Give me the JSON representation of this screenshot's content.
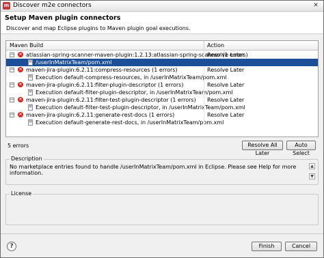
{
  "window": {
    "title": "Discover m2e connectors",
    "close_glyph": "✕",
    "icon": "m2e-icon"
  },
  "header": {
    "title": "Setup Maven plugin connectors",
    "description": "Discover and map Eclipse plugins to Maven plugin goal executions."
  },
  "table": {
    "columns": [
      "Maven Build",
      "Action"
    ],
    "rows": [
      {
        "kind": "plugin",
        "text": "atlassian-spring-scanner-maven-plugin:1.2.13:atlassian-spring-scanner (1 errors)",
        "action": "Resolve Later",
        "selected": false
      },
      {
        "kind": "file",
        "text": "/userInMatrixTeam/pom.xml",
        "action": "",
        "selected": true
      },
      {
        "kind": "plugin",
        "text": "maven-jira-plugin:6.2.11:compress-resources (1 errors)",
        "action": "Resolve Later",
        "selected": false
      },
      {
        "kind": "file",
        "text": "Execution default-compress-resources, in /userInMatrixTeam/pom.xml",
        "action": "",
        "selected": false
      },
      {
        "kind": "plugin",
        "text": "maven-jira-plugin:6.2.11:filter-plugin-descriptor (1 errors)",
        "action": "Resolve Later",
        "selected": false
      },
      {
        "kind": "file",
        "text": "Execution default-filter-plugin-descriptor, in /userInMatrixTeam/pom.xml",
        "action": "",
        "selected": false
      },
      {
        "kind": "plugin",
        "text": "maven-jira-plugin:6.2.11:filter-test-plugin-descriptor (1 errors)",
        "action": "Resolve Later",
        "selected": false
      },
      {
        "kind": "file",
        "text": "Execution default-filter-test-plugin-descriptor, in /userInMatrixTeam/pom.xml",
        "action": "",
        "selected": false
      },
      {
        "kind": "plugin",
        "text": "maven-jira-plugin:6.2.11:generate-rest-docs (1 errors)",
        "action": "Resolve Later",
        "selected": false
      },
      {
        "kind": "file",
        "text": "Execution default-generate-rest-docs, in /userInMatrixTeam/pom.xml",
        "action": "",
        "selected": false
      }
    ],
    "expander_glyph": "−",
    "error_glyph": "×",
    "file_glyph": "M"
  },
  "status": {
    "error_count": "5 errors"
  },
  "buttons": {
    "resolve_all_later": "Resolve All Later",
    "auto_select": "Auto Select",
    "finish": "Finish",
    "cancel": "Cancel",
    "help_glyph": "?"
  },
  "description": {
    "label": "Description",
    "text": "No marketplace entries found to handle /userInMatrixTeam/pom.xml in Eclipse.  Please see Help for more information.",
    "scroll_up": "▲",
    "scroll_down": "▼"
  },
  "license": {
    "label": "License"
  }
}
